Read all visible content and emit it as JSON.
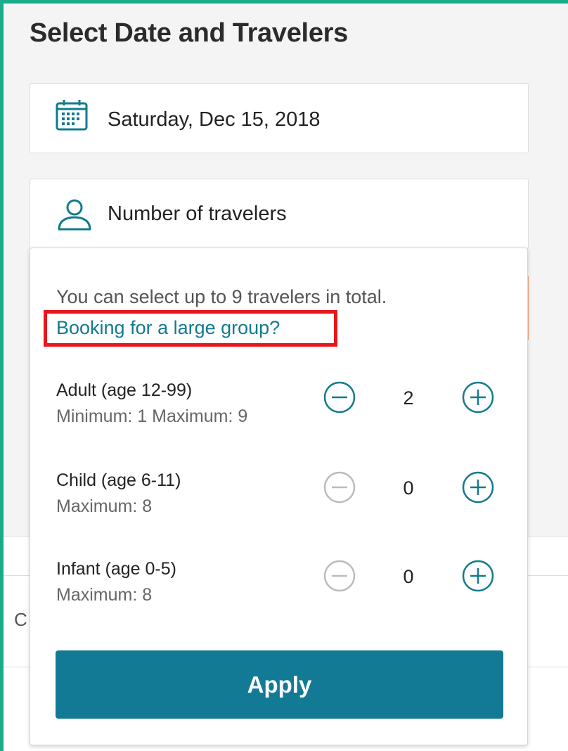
{
  "title": "Select Date and Travelers",
  "date_picker": {
    "value": "Saturday, Dec 15, 2018",
    "icon": "calendar-icon"
  },
  "travelers_field": {
    "label": "Number of travelers",
    "icon": "person-icon"
  },
  "background": {
    "partial_text": "C"
  },
  "dropdown": {
    "info": "You can select up to 9 travelers in total.",
    "group_link": "Booking for a large group?",
    "rows": [
      {
        "label": "Adult (age 12-99)",
        "limits": "Minimum: 1 Maximum: 9",
        "count": "2",
        "minus_enabled": true
      },
      {
        "label": "Child (age 6-11)",
        "limits": "Maximum: 8",
        "count": "0",
        "minus_enabled": false
      },
      {
        "label": "Infant (age 0-5)",
        "limits": "Maximum: 8",
        "count": "0",
        "minus_enabled": false
      }
    ],
    "apply_label": "Apply"
  },
  "colors": {
    "accent": "#137a96",
    "link": "#127a8e",
    "disabled": "#bbbbbb",
    "highlight": "#e8151b",
    "frame": "#1aab8a"
  }
}
